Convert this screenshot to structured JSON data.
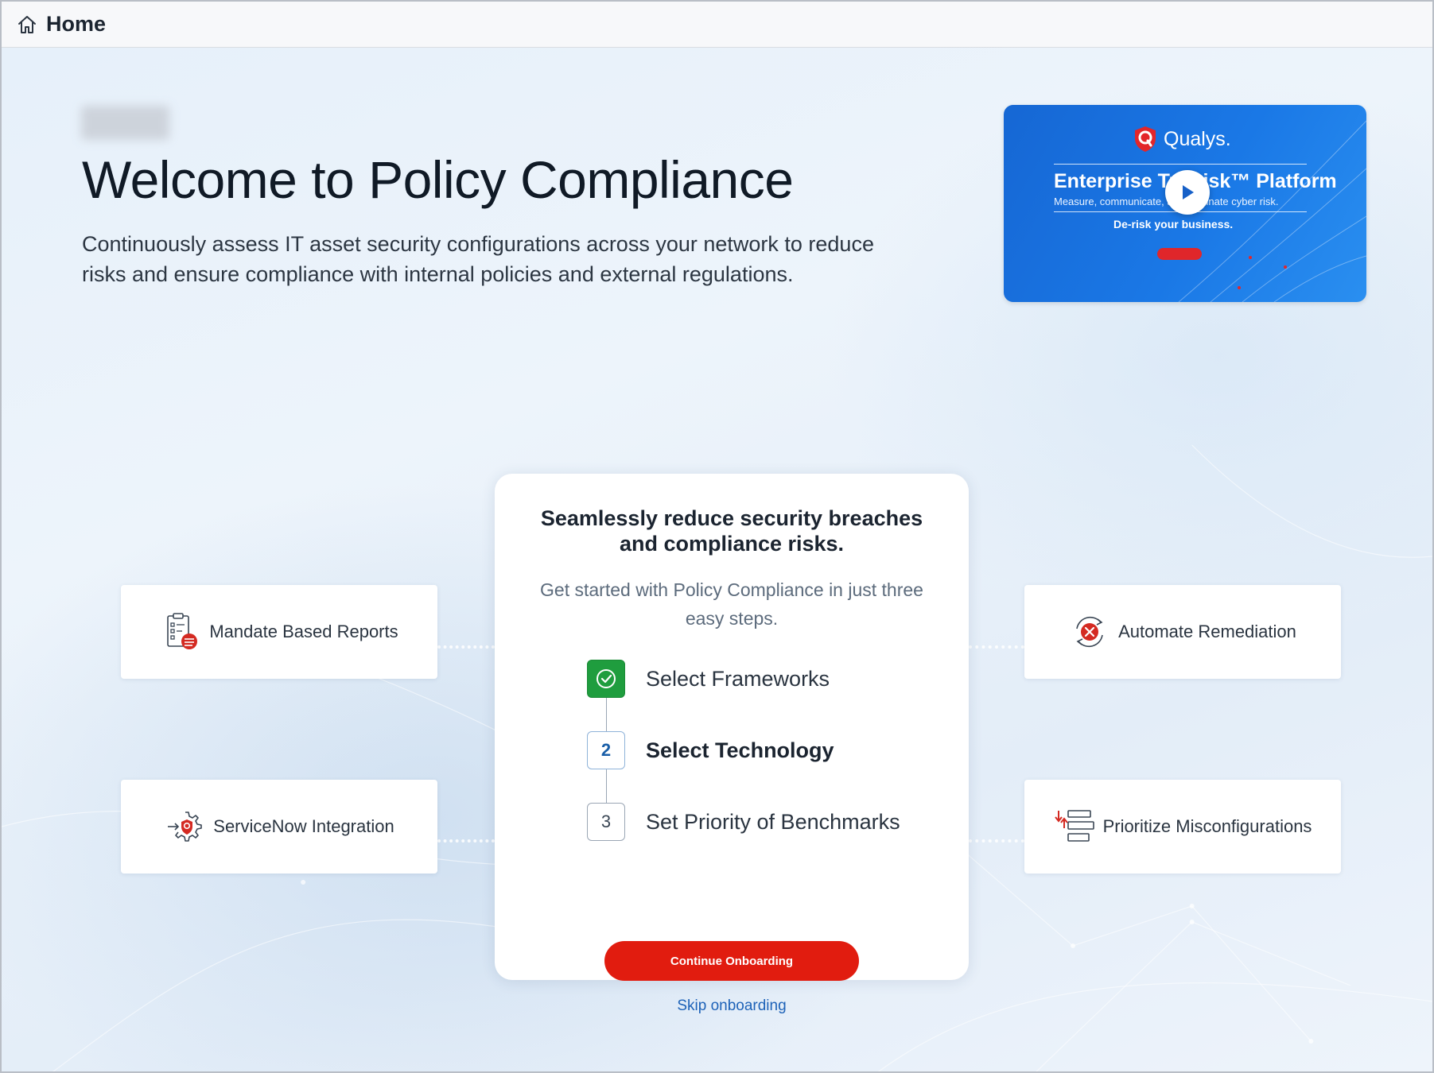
{
  "topbar": {
    "title": "Home",
    "icon": "home-icon"
  },
  "hero": {
    "title": "Welcome to Policy Compliance",
    "subtitle": "Continuously assess IT asset security configurations across your network to reduce risks and ensure compliance with internal policies and external regulations."
  },
  "video": {
    "brand": "Qualys.",
    "title": "Enterprise TruRisk™ Platform",
    "tagline": "Measure, communicate, and eliminate cyber risk.",
    "derisk": "De-risk your business.",
    "play_icon": "play-icon"
  },
  "features": {
    "mandate_reports": {
      "label": "Mandate Based Reports",
      "icon": "report-checklist-icon"
    },
    "servicenow": {
      "label": "ServiceNow Integration",
      "icon": "gear-shield-icon"
    },
    "remediation": {
      "label": "Automate Remediation",
      "icon": "remediation-cycle-icon"
    },
    "misconfig": {
      "label": "Prioritize Misconfigurations",
      "icon": "priority-stack-icon"
    }
  },
  "onboarding": {
    "title": "Seamlessly reduce security breaches and compliance risks.",
    "subtitle": "Get started with Policy Compliance in just three easy steps.",
    "steps": [
      {
        "number": "1",
        "label": "Select Frameworks",
        "status": "done"
      },
      {
        "number": "2",
        "label": "Select Technology",
        "status": "active"
      },
      {
        "number": "3",
        "label": "Set Priority of Benchmarks",
        "status": "pending"
      }
    ],
    "continue_label": "Continue Onboarding",
    "skip_label": "Skip onboarding"
  },
  "colors": {
    "accent_red": "#e11c0f",
    "success_green": "#1f9d3e",
    "link_blue": "#1d62b8",
    "video_blue": "#1a78e6"
  }
}
